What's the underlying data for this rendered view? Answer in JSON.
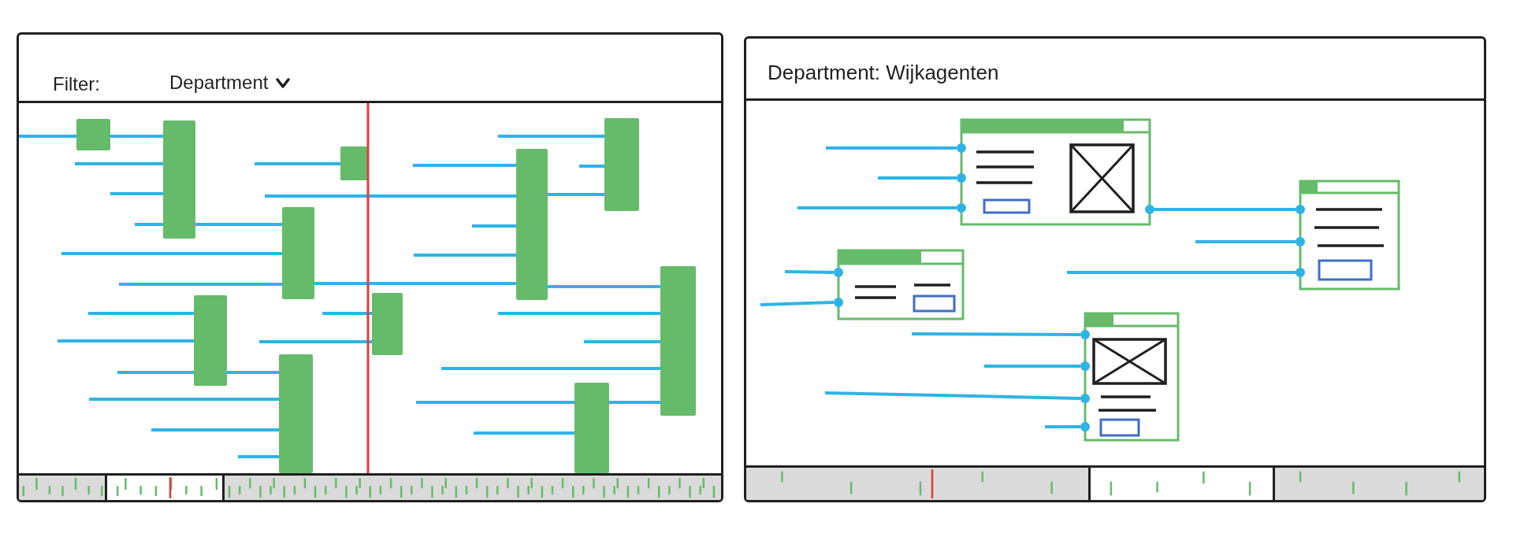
{
  "panels": [
    {
      "kind": "timeline",
      "header": {
        "label": "Filter:",
        "dropdown": {
          "value": "Department"
        }
      }
    },
    {
      "kind": "diagram",
      "header": {
        "title": "Department: Wijkagenten"
      }
    }
  ]
}
